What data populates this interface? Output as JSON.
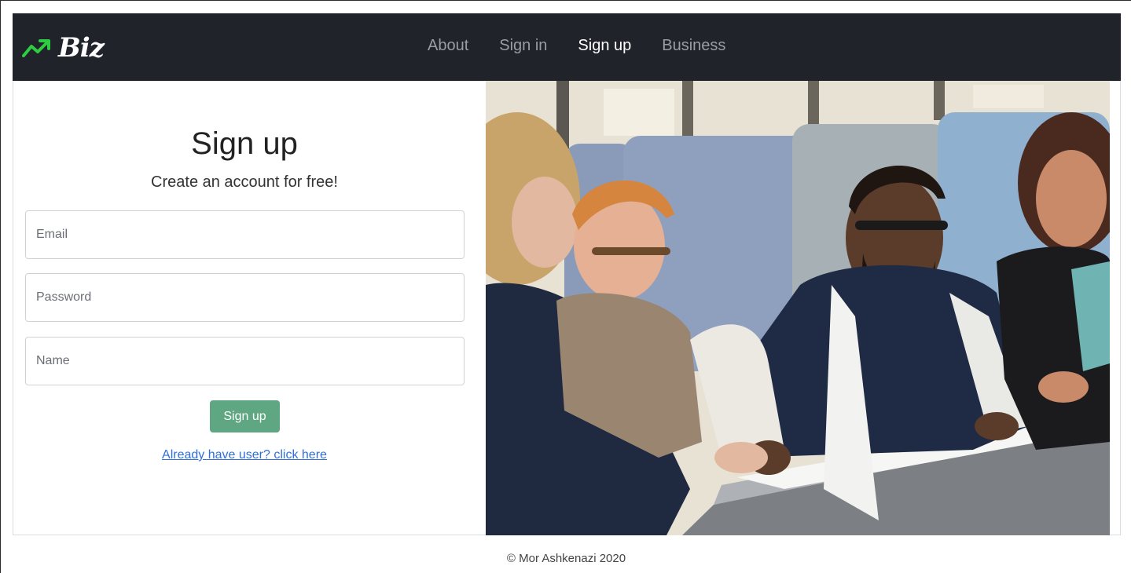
{
  "brand": {
    "name": "Biz",
    "icon": "trending-up-icon",
    "accent": "#2ecc40"
  },
  "nav": {
    "items": [
      {
        "label": "About",
        "active": false
      },
      {
        "label": "Sign in",
        "active": false
      },
      {
        "label": "Sign up",
        "active": true
      },
      {
        "label": "Business",
        "active": false
      }
    ]
  },
  "form": {
    "title": "Sign up",
    "subtitle": "Create an account for free!",
    "email": {
      "placeholder": "Email",
      "value": ""
    },
    "password": {
      "placeholder": "Password",
      "value": ""
    },
    "name": {
      "placeholder": "Name",
      "value": ""
    },
    "submit_label": "Sign up",
    "login_link": "Already have user? click here",
    "button_color": "#5fa682"
  },
  "hero_image": {
    "subject": "office-meeting-photo"
  },
  "footer": {
    "text": "© Mor Ashkenazi 2020"
  }
}
